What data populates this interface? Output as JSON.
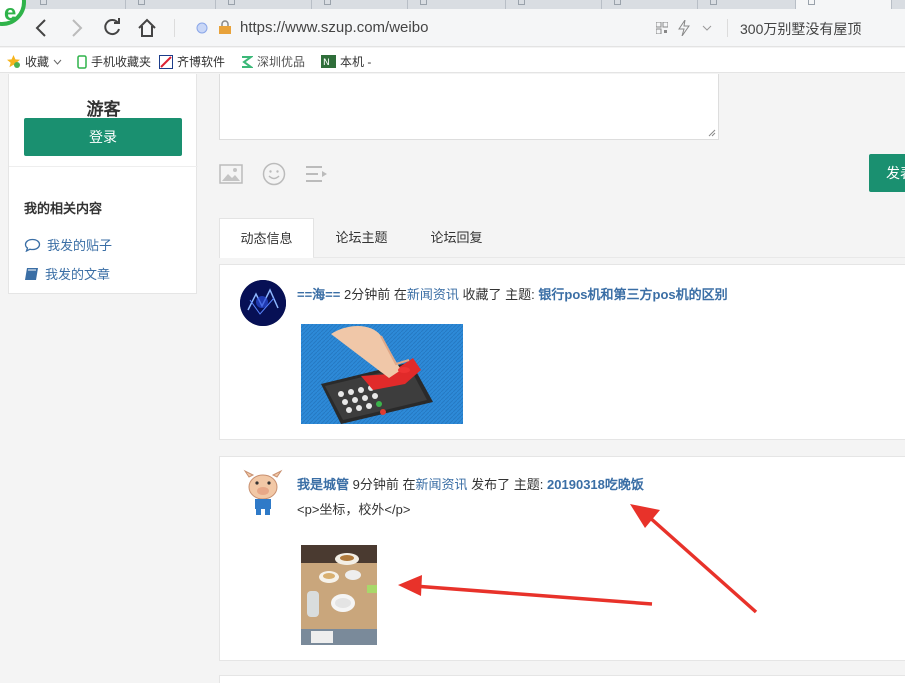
{
  "browser": {
    "url": "https://www.szup.com/weibo",
    "search_hint": "300万别墅没有屋顶",
    "bookmarks": [
      {
        "label": "收藏",
        "icon": "star-icon"
      },
      {
        "label": "手机收藏夹",
        "icon": "phone-icon"
      },
      {
        "label": "齐博软件",
        "icon": "qibo-icon"
      },
      {
        "label": "深圳优品",
        "icon": "szup-icon"
      },
      {
        "label": "本机 - ",
        "icon": "local-icon"
      }
    ]
  },
  "sidebar": {
    "guest_name": "游客",
    "login_label": "登录",
    "section_title": "我的相关内容",
    "links": [
      {
        "label": "我发的贴子",
        "icon": "speech-bubble-icon"
      },
      {
        "label": "我发的文章",
        "icon": "book-icon"
      }
    ]
  },
  "composer": {
    "post_label": "发表"
  },
  "tabs": [
    {
      "label": "动态信息"
    },
    {
      "label": "论坛主题"
    },
    {
      "label": "论坛回复"
    }
  ],
  "feed": [
    {
      "user": "==海==",
      "time": "2分钟前",
      "in_label": "在",
      "category": "新闻资讯",
      "action": "收藏了",
      "topic_label": "主题:",
      "topic": "银行pos机和第三方pos机的区别",
      "image": "pos-machine-photo"
    },
    {
      "user": "我是城管",
      "time": "9分钟前",
      "in_label": "在",
      "category": "新闻资讯",
      "action": "发布了",
      "topic_label": "主题:",
      "topic": "20190318吃晚饭",
      "content": "<p>坐标，校外</p>",
      "image": "dinner-table-photo"
    }
  ],
  "colors": {
    "brand": "#1a9070",
    "link": "#3a6ea5",
    "annotation_arrow": "#e8322a"
  }
}
